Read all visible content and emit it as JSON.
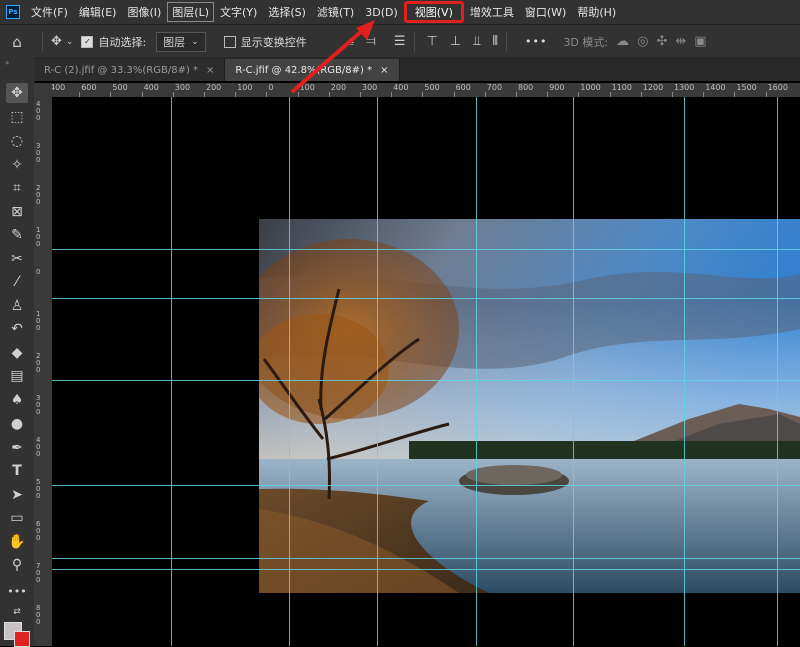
{
  "app": {
    "logo_text": "Ps"
  },
  "menu": {
    "items": [
      {
        "label": "文件(F)"
      },
      {
        "label": "编辑(E)"
      },
      {
        "label": "图像(I)"
      },
      {
        "label": "图层(L)"
      },
      {
        "label": "文字(Y)"
      },
      {
        "label": "选择(S)"
      },
      {
        "label": "滤镜(T)"
      },
      {
        "label": "3D(D)"
      },
      {
        "label": "视图(V)"
      },
      {
        "label": "增效工具"
      },
      {
        "label": "窗口(W)"
      },
      {
        "label": "帮助(H)"
      }
    ],
    "highlighted": "视图(V)",
    "highlight_color": "#e0201e"
  },
  "options": {
    "auto_select_label": "自动选择:",
    "auto_select_checked": true,
    "layer_dropdown": "图层",
    "show_transform_label": "显示变换控件",
    "show_transform_checked": false,
    "mode_3d_label": "3D 模式:",
    "more_label": "•••"
  },
  "tabs": [
    {
      "label": "R-C (2).jfif @ 33.3%(RGB/8#) *",
      "close": "×",
      "active": false
    },
    {
      "label": "R-C.jfif @ 42.8%(RGB/8#) *",
      "close": "×",
      "active": true
    }
  ],
  "ruler": {
    "top_labels": [
      "400",
      "600",
      "500",
      "400",
      "300",
      "200",
      "100",
      "0",
      "100",
      "200",
      "300",
      "400",
      "500",
      "600",
      "700",
      "800",
      "900",
      "1000",
      "1100",
      "1200",
      "1300",
      "1400",
      "1500",
      "1600"
    ],
    "left_labels": [
      "400",
      "300",
      "200",
      "100",
      "0",
      "100",
      "200",
      "300",
      "400",
      "500",
      "600",
      "700",
      "800"
    ]
  },
  "colors": {
    "guide": "#5fd3e0",
    "foreground": "#c8c2c2",
    "background": "#dd2222",
    "arrow": "#e0201e"
  }
}
